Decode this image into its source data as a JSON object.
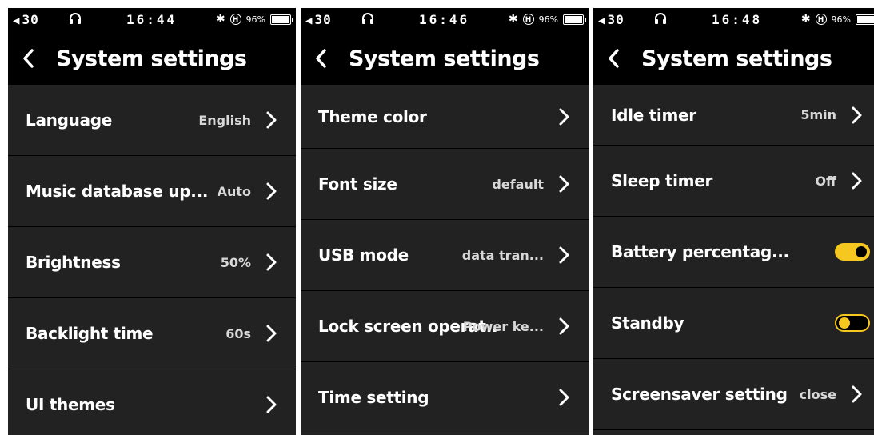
{
  "screens": [
    {
      "status": {
        "volume": "30",
        "time": "16:44",
        "battery": "96%"
      },
      "title": "System settings",
      "rows": [
        {
          "label": "Language",
          "value": "English"
        },
        {
          "label": "Music database up...",
          "value": "Auto"
        },
        {
          "label": "Brightness",
          "value": "50%"
        },
        {
          "label": "Backlight time",
          "value": "60s"
        },
        {
          "label": "UI themes",
          "value": ""
        }
      ]
    },
    {
      "status": {
        "volume": "30",
        "time": "16:46",
        "battery": "96%"
      },
      "title": "System settings",
      "rows": [
        {
          "label": "Theme color",
          "value": ""
        },
        {
          "label": "Font size",
          "value": "default"
        },
        {
          "label": "USB mode",
          "value": "data tran..."
        },
        {
          "label": "Lock screen operat..",
          "value": "Power ke..."
        },
        {
          "label": "Time setting",
          "value": ""
        }
      ]
    },
    {
      "status": {
        "volume": "30",
        "time": "16:48",
        "battery": "96%"
      },
      "title": "System settings",
      "rows": [
        {
          "label": "Idle timer",
          "value": "5min"
        },
        {
          "label": "Sleep timer",
          "value": "Off"
        },
        {
          "label": "Battery percentag...",
          "toggle": true
        },
        {
          "label": "Standby",
          "toggle": false
        },
        {
          "label": "Screensaver setting",
          "value": "close"
        }
      ]
    }
  ],
  "colors": {
    "accent": "#f6c71e",
    "background": "#222222",
    "bar": "#000000"
  }
}
